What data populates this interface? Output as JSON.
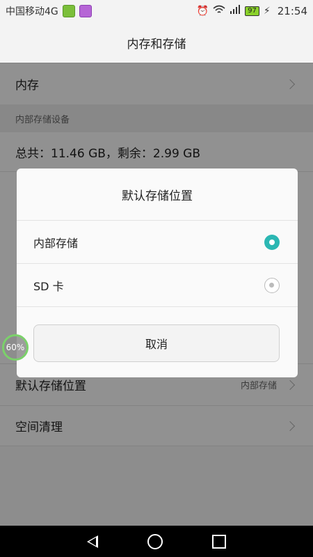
{
  "status_bar": {
    "carrier": "中国移动4G",
    "battery": "97",
    "time": "21:54"
  },
  "header": {
    "title": "内存和存储"
  },
  "background": {
    "memory_label": "内存",
    "section_internal": "内部存储设备",
    "total_text": "总共：11.46 GB，剩余：2.99 GB",
    "default_location_label": "默认存储位置",
    "default_location_value": "内部存储",
    "cleanup_label": "空间清理"
  },
  "dialog": {
    "title": "默认存储位置",
    "options": [
      {
        "label": "内部存储",
        "selected": true
      },
      {
        "label": "SD 卡",
        "selected": false
      }
    ],
    "cancel_label": "取消"
  },
  "float_badge": {
    "progress": "60%"
  },
  "colors": {
    "accent": "#2bb7b3",
    "badge_ring": "#7bd16a"
  }
}
